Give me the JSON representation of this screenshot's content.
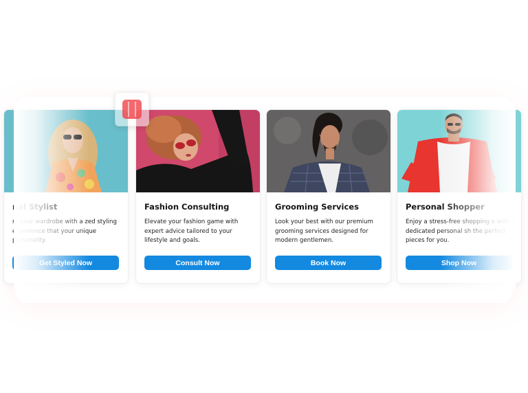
{
  "cards": [
    {
      "title": "nal Stylist",
      "description": "m your wardrobe with a zed styling experience that your unique personality.",
      "cta": "Get Styled Now",
      "image": "woman-sunglasses-floral-top-photo"
    },
    {
      "title": "Fashion Consulting",
      "description": "Elevate your fashion game with expert advice tailored to your lifestyle and goals.",
      "cta": "Consult Now",
      "image": "woman-red-sunglasses-photo"
    },
    {
      "title": "Grooming Services",
      "description": "Look your best with our premium grooming services designed for modern gentlemen.",
      "cta": "Book Now",
      "image": "man-plaid-blazer-photo"
    },
    {
      "title": "Personal Shopper",
      "description": "Enjoy a stress-free shopping e with a dedicated personal sh the perfect pieces for you.",
      "cta": "Shop Now",
      "image": "man-red-jacket-photo"
    }
  ],
  "drag_handle": {
    "icon": "drag-handle-icon"
  },
  "colors": {
    "cta_blue": "#1389e0",
    "handle_red": "#f04a4f",
    "title_text": "#151515"
  }
}
